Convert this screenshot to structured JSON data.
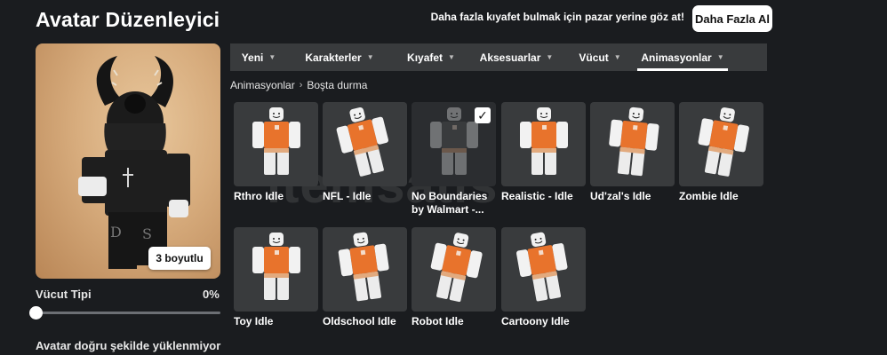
{
  "page": {
    "title": "Avatar Düzenleyici",
    "promo_text": "Daha fazla kıyafet bulmak için pazar yerine göz at!",
    "promo_button": "Daha Fazla Al"
  },
  "avatar": {
    "view_3d_button": "3 boyutlu",
    "body_type_label": "Vücut Tipi",
    "body_type_value": "0%",
    "body_type_fraction": 0,
    "warning": "Avatar doğru şekilde yüklenmiyor"
  },
  "nav": {
    "tabs": [
      {
        "label": "Yeni"
      },
      {
        "label": "Karakterler"
      },
      {
        "label": "Kıyafet"
      },
      {
        "label": "Aksesuarlar"
      },
      {
        "label": "Vücut"
      },
      {
        "label": "Animasyonlar",
        "active": true
      }
    ],
    "chevron_icon": "chevron-down-icon"
  },
  "breadcrumb": {
    "parent": "Animasyonlar",
    "separator": "›",
    "current": "Boşta durma"
  },
  "items": [
    {
      "name": "Rthro Idle",
      "selected": false
    },
    {
      "name": "NFL - Idle",
      "selected": false
    },
    {
      "name": "No Boundaries by Walmart -...",
      "selected": true
    },
    {
      "name": "Realistic - Idle",
      "selected": false
    },
    {
      "name": "Ud'zal's Idle",
      "selected": false
    },
    {
      "name": "Zombie Idle",
      "selected": false
    },
    {
      "name": "Toy Idle",
      "selected": false
    },
    {
      "name": "Oldschool Idle",
      "selected": false
    },
    {
      "name": "Robot Idle",
      "selected": false
    },
    {
      "name": "Cartoony Idle",
      "selected": false
    }
  ],
  "watermark": "itemsatis",
  "colors": {
    "background": "#1a1c1f",
    "card": "#393b3d",
    "shirt": "#e8732c",
    "preview_bg": "#d7ac7d"
  }
}
